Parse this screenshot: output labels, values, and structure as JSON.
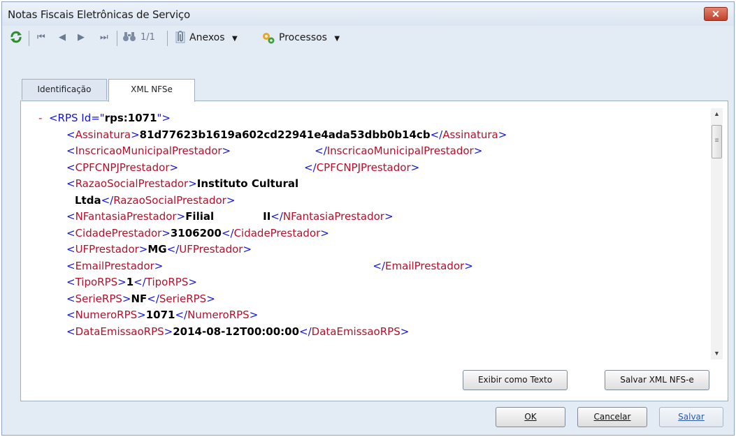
{
  "window": {
    "title": "Notas Fiscais Eletrônicas de Serviço",
    "close_label": "✕"
  },
  "toolbar": {
    "refresh_icon": "refresh-icon",
    "page_indicator": "1/1",
    "anexos_label": "Anexos",
    "processos_label": "Processos"
  },
  "tabs": [
    {
      "label": "Identificação",
      "active": false
    },
    {
      "label": "XML NFSe",
      "active": true
    }
  ],
  "xml": {
    "root_minus": "-",
    "root_open_prefix": "<RPS Id=\"",
    "root_id": "rps:1071",
    "root_open_suffix": "\">",
    "fields": [
      {
        "tag": "Assinatura",
        "value": "81d77623b1619a602cd22941e4ada53dbb0b14cb"
      },
      {
        "tag": "InscricaoMunicipalPrestador",
        "value": ""
      },
      {
        "tag": "CPFCNPJPrestador",
        "value": ""
      },
      {
        "tag": "RazaoSocialPrestador",
        "value": "Instituto Cultural",
        "value_cont": "Ltda"
      },
      {
        "tag": "NFantasiaPrestador",
        "value": "Filial",
        "value2": "II"
      },
      {
        "tag": "CidadePrestador",
        "value": "3106200"
      },
      {
        "tag": "UFPrestador",
        "value": "MG"
      },
      {
        "tag": "EmailPrestador",
        "value": ""
      },
      {
        "tag": "TipoRPS",
        "value": "1"
      },
      {
        "tag": "SerieRPS",
        "value": "NF"
      },
      {
        "tag": "NumeroRPS",
        "value": "1071"
      },
      {
        "tag": "DataEmissaoRPS",
        "value": "2014-08-12T00:00:00"
      }
    ]
  },
  "panel_buttons": {
    "exibir_texto": "Exibir como Texto",
    "salvar_xml": "Salvar XML NFS-e"
  },
  "footer_buttons": {
    "ok": "OK",
    "cancelar": "Cancelar",
    "salvar": "Salvar"
  },
  "colors": {
    "tag": "#b5102b",
    "angle": "#1414d6",
    "value": "#000000",
    "window_bg": "#e3ebf5"
  }
}
